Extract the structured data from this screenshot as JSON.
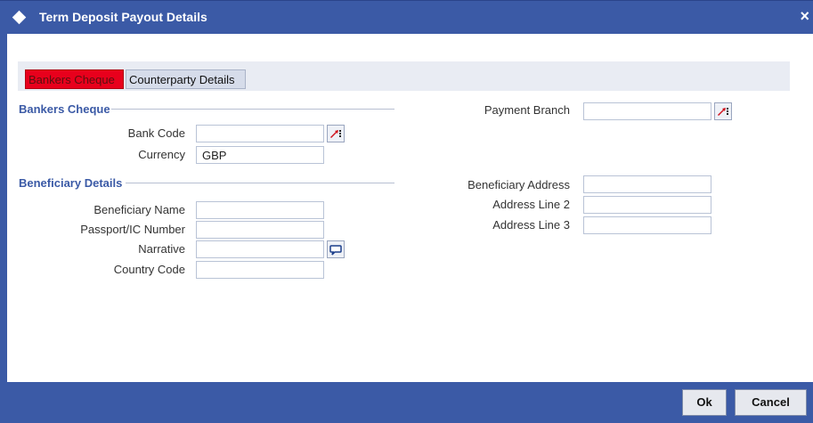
{
  "window": {
    "title": "Term Deposit Payout Details",
    "close_label": "×"
  },
  "tabs": [
    {
      "label": "Bankers Cheque",
      "active": true
    },
    {
      "label": "Counterparty Details",
      "active": false
    }
  ],
  "sections": {
    "bankers_cheque": {
      "title": "Bankers Cheque"
    },
    "beneficiary_details": {
      "title": "Beneficiary Details"
    }
  },
  "fields": {
    "bank_code": {
      "label": "Bank Code",
      "value": ""
    },
    "currency": {
      "label": "Currency",
      "value": "GBP"
    },
    "payment_branch": {
      "label": "Payment Branch",
      "value": ""
    },
    "beneficiary_name": {
      "label": "Beneficiary Name",
      "value": ""
    },
    "passport_ic_number": {
      "label": "Passport/IC Number",
      "value": ""
    },
    "narrative": {
      "label": "Narrative",
      "value": ""
    },
    "country_code": {
      "label": "Country Code",
      "value": ""
    },
    "beneficiary_address": {
      "label": "Beneficiary Address",
      "value": ""
    },
    "address_line_2": {
      "label": "Address Line 2",
      "value": ""
    },
    "address_line_3": {
      "label": "Address Line 3",
      "value": ""
    }
  },
  "buttons": {
    "ok": "Ok",
    "cancel": "Cancel"
  },
  "colors": {
    "titlebar": "#3b5aa6",
    "active_tab": "#e8001c",
    "section_title": "#3b5aa6"
  },
  "icons": {
    "lov": "lov-search-icon",
    "narrative": "speech-bubble-icon"
  }
}
